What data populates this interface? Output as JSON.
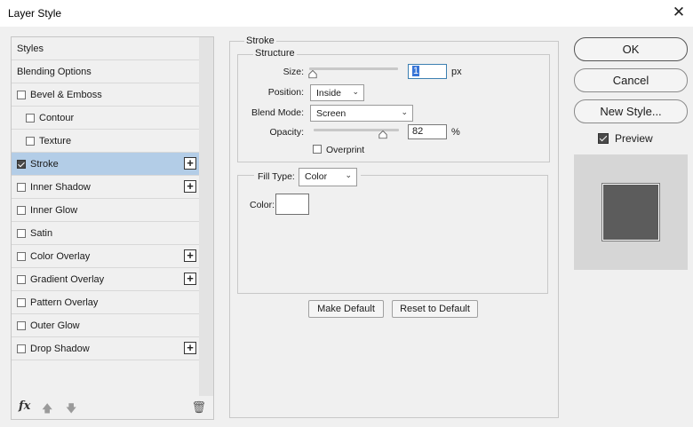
{
  "window": {
    "title": "Layer Style",
    "close_glyph": "✕"
  },
  "styles_panel": {
    "items": [
      {
        "label": "Styles",
        "checkbox": false,
        "checked": false,
        "sub": false,
        "plus": false,
        "selected": false
      },
      {
        "label": "Blending Options",
        "checkbox": false,
        "checked": false,
        "sub": false,
        "plus": false,
        "selected": false
      },
      {
        "label": "Bevel & Emboss",
        "checkbox": true,
        "checked": false,
        "sub": false,
        "plus": false,
        "selected": false
      },
      {
        "label": "Contour",
        "checkbox": true,
        "checked": false,
        "sub": true,
        "plus": false,
        "selected": false
      },
      {
        "label": "Texture",
        "checkbox": true,
        "checked": false,
        "sub": true,
        "plus": false,
        "selected": false
      },
      {
        "label": "Stroke",
        "checkbox": true,
        "checked": true,
        "sub": false,
        "plus": true,
        "selected": true
      },
      {
        "label": "Inner Shadow",
        "checkbox": true,
        "checked": false,
        "sub": false,
        "plus": true,
        "selected": false
      },
      {
        "label": "Inner Glow",
        "checkbox": true,
        "checked": false,
        "sub": false,
        "plus": false,
        "selected": false
      },
      {
        "label": "Satin",
        "checkbox": true,
        "checked": false,
        "sub": false,
        "plus": false,
        "selected": false
      },
      {
        "label": "Color Overlay",
        "checkbox": true,
        "checked": false,
        "sub": false,
        "plus": true,
        "selected": false
      },
      {
        "label": "Gradient Overlay",
        "checkbox": true,
        "checked": false,
        "sub": false,
        "plus": true,
        "selected": false
      },
      {
        "label": "Pattern Overlay",
        "checkbox": true,
        "checked": false,
        "sub": false,
        "plus": false,
        "selected": false
      },
      {
        "label": "Outer Glow",
        "checkbox": true,
        "checked": false,
        "sub": false,
        "plus": false,
        "selected": false
      },
      {
        "label": "Drop Shadow",
        "checkbox": true,
        "checked": false,
        "sub": false,
        "plus": true,
        "selected": false
      }
    ],
    "footer": {
      "fx": "fx",
      "up": "🡅",
      "down": "🡇",
      "trash": "🗑"
    }
  },
  "stroke": {
    "group_title": "Stroke",
    "structure_title": "Structure",
    "size": {
      "label": "Size:",
      "value": "1",
      "unit": "px",
      "level": 0.0
    },
    "position": {
      "label": "Position:",
      "value": "Inside"
    },
    "blend_mode": {
      "label": "Blend Mode:",
      "value": "Screen"
    },
    "opacity": {
      "label": "Opacity:",
      "value": "82",
      "unit": "%",
      "level": 0.82
    },
    "overprint": {
      "label": "Overprint",
      "checked": false
    },
    "fill_type": {
      "label": "Fill Type:",
      "value": "Color"
    },
    "color": {
      "label": "Color:",
      "swatch": "#ffffff"
    },
    "make_default": "Make Default",
    "reset_default": "Reset to Default"
  },
  "actions": {
    "ok": "OK",
    "cancel": "Cancel",
    "new_style": "New Style...",
    "preview_label": "Preview",
    "preview_checked": true,
    "preview_swatch_color": "#5c5c5c"
  },
  "colors": {
    "selected_row": "#b3cde7",
    "focus_border": "#3c7fb1"
  }
}
